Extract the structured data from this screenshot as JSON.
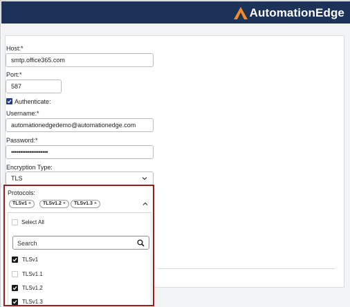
{
  "brand": {
    "name": "AutomationEdge",
    "accent": "#f28c28",
    "bar_color": "#1c3259"
  },
  "form": {
    "host": {
      "label": "Host:*",
      "value": "smtp.office365.com"
    },
    "port": {
      "label": "Port:*",
      "value": "587"
    },
    "authenticate": {
      "label": "Authenticate:",
      "checked": true
    },
    "username": {
      "label": "Username:*",
      "value": "automationedgedemo@automationedge.com"
    },
    "password": {
      "label": "Password:*",
      "value": "••••••••••••••••••••"
    },
    "encryption": {
      "label": "Encryption Type:",
      "value": "TLS"
    },
    "protocols": {
      "label": "Protocols:",
      "selected_chips": [
        {
          "label": "TLSv1",
          "remove": "×"
        },
        {
          "label": "TLSv1.2",
          "remove": "×"
        },
        {
          "label": "TLSv1.3",
          "remove": "×"
        }
      ],
      "select_all_label": "Select All",
      "search_placeholder": "Search",
      "options": [
        {
          "label": "TLSv1",
          "checked": true
        },
        {
          "label": "TLSv1.1",
          "checked": false
        },
        {
          "label": "TLSv1.2",
          "checked": true
        },
        {
          "label": "TLSv1.3",
          "checked": true
        }
      ],
      "highlight_color": "#9c1c1c"
    }
  }
}
